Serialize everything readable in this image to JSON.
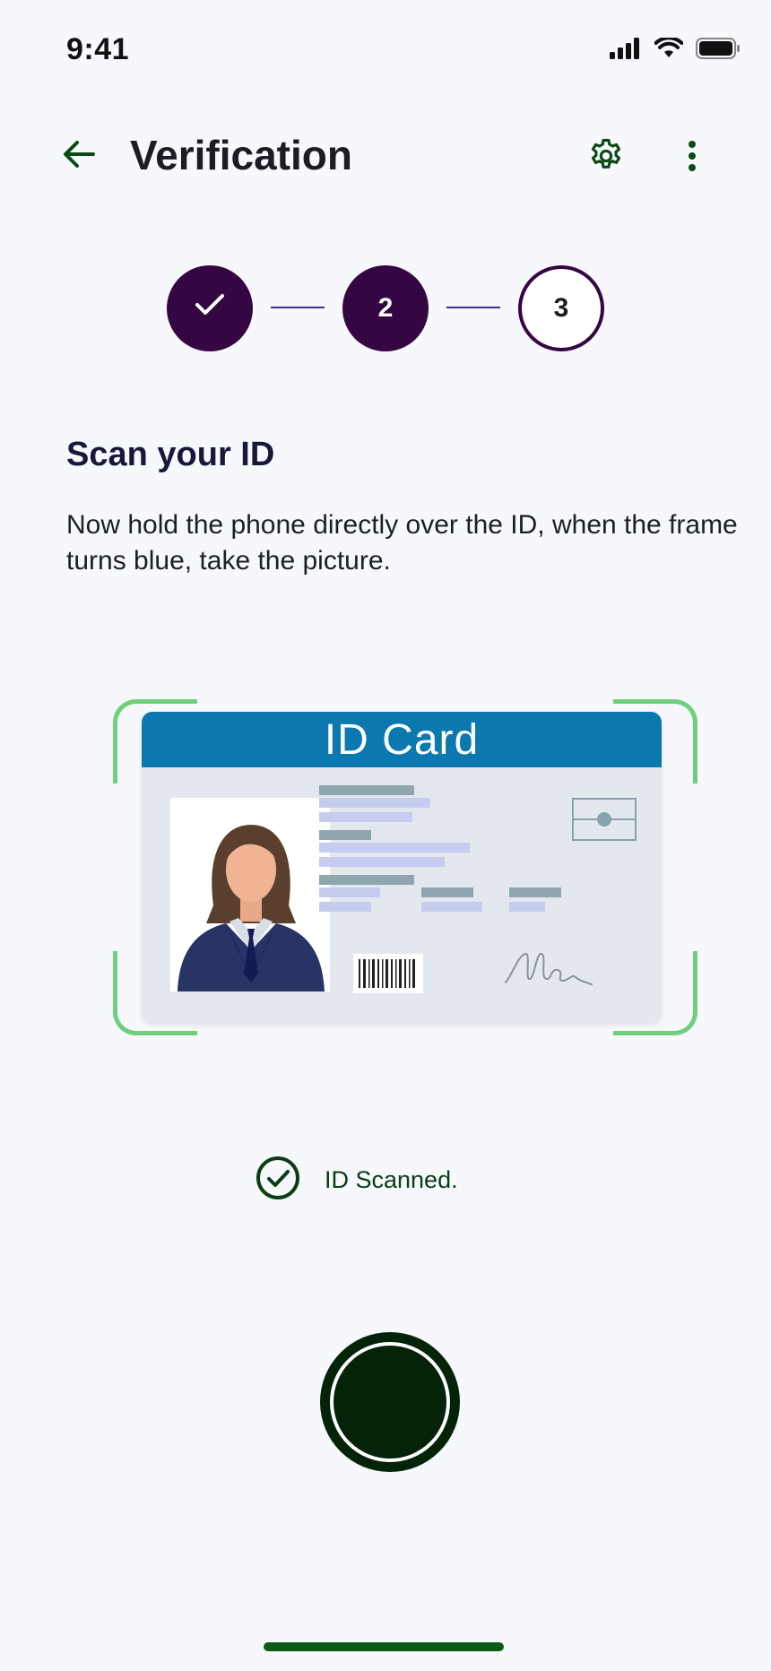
{
  "status_bar": {
    "time": "9:41",
    "icons": [
      "signal-icon",
      "wifi-icon",
      "battery-icon"
    ]
  },
  "top_bar": {
    "back_icon": "arrow-left-icon",
    "title": "Verification",
    "settings_icon": "gear-icon",
    "more_icon": "more-vertical-icon"
  },
  "stepper": {
    "steps": [
      {
        "label": "",
        "state": "done",
        "icon": "check-icon"
      },
      {
        "label": "2",
        "state": "active"
      },
      {
        "label": "3",
        "state": "pending"
      }
    ]
  },
  "content": {
    "title": "Scan your ID",
    "description": "Now hold the phone directly over the ID, when the frame turns blue, take the picture."
  },
  "id_card": {
    "header": "ID Card",
    "header_color": "#0b78b0",
    "frame_color": "#6fcf7c"
  },
  "scan_status": {
    "icon": "check-circle-icon",
    "text": "ID Scanned."
  },
  "colors": {
    "accent": "#340642",
    "primary_green": "#052308",
    "background": "#f6f8fc"
  }
}
